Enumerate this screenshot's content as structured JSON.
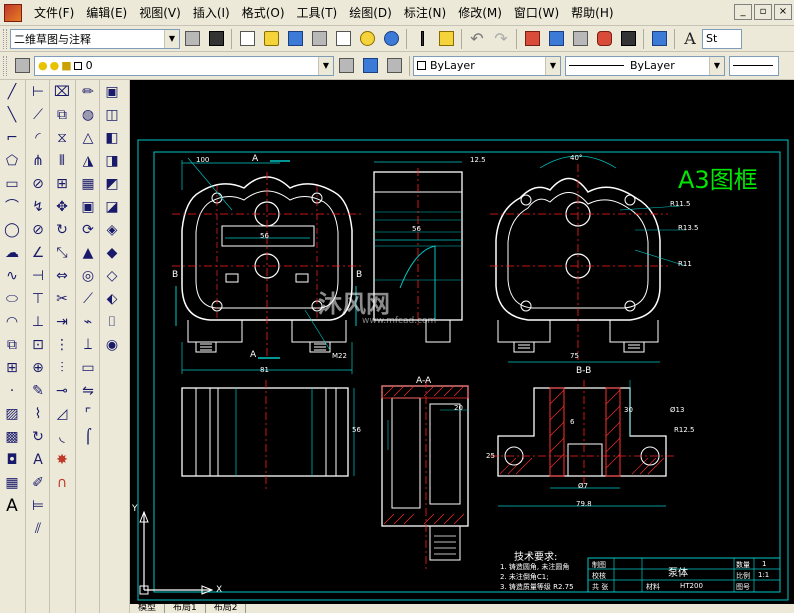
{
  "menu": {
    "items": [
      "文件(F)",
      "编辑(E)",
      "视图(V)",
      "插入(I)",
      "格式(O)",
      "工具(T)",
      "绘图(D)",
      "标注(N)",
      "修改(M)",
      "窗口(W)",
      "帮助(H)"
    ]
  },
  "window_controls": [
    "_",
    "▫",
    "×"
  ],
  "toolbar1": {
    "workspace": "二维草图与注释",
    "style_text": "St"
  },
  "toolbar2": {
    "layer": "0",
    "color": "ByLayer",
    "linetype": "ByLayer"
  },
  "drawing": {
    "title_block_label": "A3图框",
    "dim_100": "100",
    "dim_A_top": "A",
    "dim_A_bottom": "A",
    "dim_12_5": "12.5",
    "dim_40deg": "40°",
    "dim_56_side": "56",
    "dim_56_front": "56",
    "dim_81": "81",
    "dim_M22": "M22",
    "dim_75": "75",
    "dim_R115": "R11.5",
    "dim_R135": "R13.5",
    "dim_R11": "R11",
    "section_AA": "A-A",
    "section_BB": "B-B",
    "dim_20": "20",
    "dim_13": "Ø13",
    "dim_30": "30",
    "dim_6": "6",
    "dim_25": "25",
    "dim_7": "Ø7",
    "dim_79_8": "79.8",
    "dim_56_left": "56",
    "dim_R12_5": "R12.5",
    "label_B_left": "B",
    "label_B_right": "B",
    "tech_req_title": "技术要求:",
    "tech_req_1": "1. 铸造圆角, 未注圆角",
    "tech_req_2": "2. 未注倒角C1;",
    "tech_req_3": "3. 铸造质量等级 R2.75",
    "tb_part_name": "泵体",
    "tb_drawn": "制图",
    "tb_checked": "校核",
    "tb_qty": "数量",
    "tb_qty_val": "1",
    "tb_scale": "比例",
    "tb_scale_val": "1:1",
    "tb_material_label": "材料",
    "tb_material": "HT200",
    "tb_sheet": "共 张",
    "tb_num": "图号",
    "watermark_main": "沐风网",
    "watermark_url": "www.mfcad.com",
    "ucs_y": "Y",
    "ucs_x": "X"
  },
  "tabs": [
    "模型",
    "布局1",
    "布局2"
  ],
  "colors": {
    "canvas": "#000000",
    "outline": "#ffffff",
    "dimension": "#00c8c8",
    "centerline": "#ff2020",
    "hatch": "#ff3030",
    "frame": "#00c8c8",
    "title": "#00e600",
    "green_text": "#00e600"
  }
}
